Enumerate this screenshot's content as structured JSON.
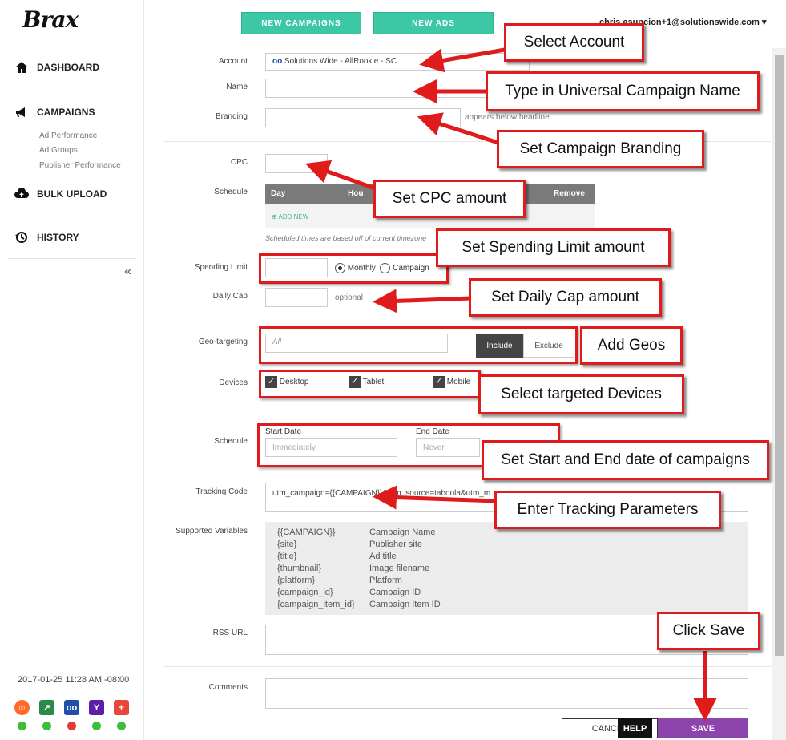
{
  "brand": {
    "logo_text": "Brax"
  },
  "header": {
    "new_campaigns": "NEW CAMPAIGNS",
    "new_ads": "NEW ADS",
    "user_email": "chris.asuncion+1@solutionswide.com"
  },
  "sidebar": {
    "dashboard": "DASHBOARD",
    "campaigns": "CAMPAIGNS",
    "sub": [
      "Ad Performance",
      "Ad Groups",
      "Publisher Performance"
    ],
    "bulk_upload": "BULK UPLOAD",
    "history": "HISTORY",
    "timestamp": "2017-01-25 11:28 AM -08:00",
    "status_colors": [
      "#3bbf3b",
      "#3bbf3b",
      "#e53935",
      "#3bbf3b",
      "#3bbf3b"
    ]
  },
  "form": {
    "account_label": "Account",
    "account_value": "Solutions Wide - AllRookie - SC",
    "name_label": "Name",
    "branding_label": "Branding",
    "branding_hint": "appears below headline",
    "cpc_label": "CPC",
    "schedule_label": "Schedule",
    "schedule_cols": {
      "day": "Day",
      "hour": "Hou",
      "remove": "Remove"
    },
    "add_new": "ADD NEW",
    "schedule_note": "Scheduled times are based off of current timezone",
    "spending_limit_label": "Spending Limit",
    "monthly": "Monthly",
    "campaign": "Campaign",
    "daily_cap_label": "Daily Cap",
    "daily_cap_hint": "optional",
    "geo_label": "Geo-targeting",
    "geo_placeholder": "All",
    "include": "Include",
    "exclude": "Exclude",
    "devices_label": "Devices",
    "devices": [
      "Desktop",
      "Tablet",
      "Mobile"
    ],
    "schedule2_label": "Schedule",
    "start_date_label": "Start Date",
    "start_date_placeholder": "Immediately",
    "end_date_label": "End Date",
    "end_date_placeholder": "Never",
    "tracking_label": "Tracking Code",
    "tracking_value": "utm_campaign={{CAMPAIGN}}&utm_source=taboola&utm_m",
    "supported_label": "Supported Variables",
    "variables": [
      [
        "{{CAMPAIGN}}",
        "Campaign Name"
      ],
      [
        "{site}",
        "Publisher site"
      ],
      [
        "{title}",
        "Ad title"
      ],
      [
        "{thumbnail}",
        "Image filename"
      ],
      [
        "{platform}",
        "Platform"
      ],
      [
        "{campaign_id}",
        "Campaign ID"
      ],
      [
        "{campaign_item_id}",
        "Campaign Item ID"
      ]
    ],
    "rss_label": "RSS URL",
    "comments_label": "Comments",
    "cancel": "CANCEL",
    "help": "HELP",
    "save": "SAVE"
  },
  "annotations": {
    "select_account": "Select Account",
    "campaign_name": "Type in Universal Campaign Name",
    "branding": "Set Campaign Branding",
    "cpc": "Set CPC amount",
    "spending_limit": "Set Spending Limit amount",
    "daily_cap": "Set Daily Cap amount",
    "geos": "Add Geos",
    "devices": "Select targeted Devices",
    "dates": "Set Start and End date of campaigns",
    "tracking": "Enter Tracking Parameters",
    "save": "Click Save"
  }
}
